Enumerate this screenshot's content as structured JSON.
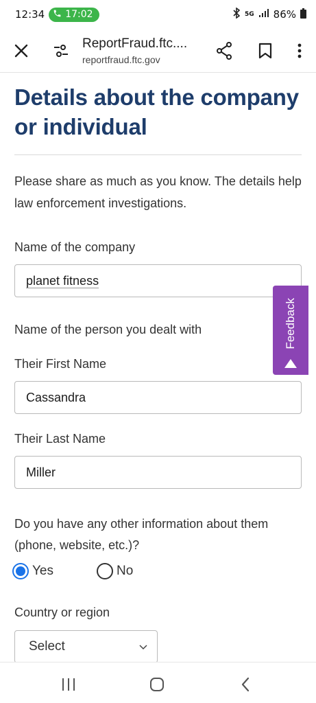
{
  "status_bar": {
    "time": "12:34",
    "call_timer": "17:02",
    "network": "5G",
    "battery": "86%"
  },
  "toolbar": {
    "page_title": "ReportFraud.ftc....",
    "domain": "reportfraud.ftc.gov"
  },
  "page": {
    "title": "Details about the company or individual",
    "intro": "Please share as much as you know. The details help law enforcement investigations."
  },
  "form": {
    "company_label": "Name of the company",
    "company_value": "planet fitness",
    "person_heading": "Name of the person you dealt with",
    "first_name_label": "Their First Name",
    "first_name_value": "Cassandra",
    "last_name_label": "Their Last Name",
    "last_name_value": "Miller",
    "other_info_question": "Do you have any other information about them (phone, website, etc.)?",
    "yes_label": "Yes",
    "no_label": "No",
    "selected_option": "Yes",
    "country_label": "Country or region",
    "country_value": "Select"
  },
  "feedback": {
    "label": "Feedback",
    "color": "#8b44b4"
  },
  "colors": {
    "title": "#1e3d6b",
    "radio_accent": "#1a73e8",
    "call_pill": "#3cb54a"
  }
}
